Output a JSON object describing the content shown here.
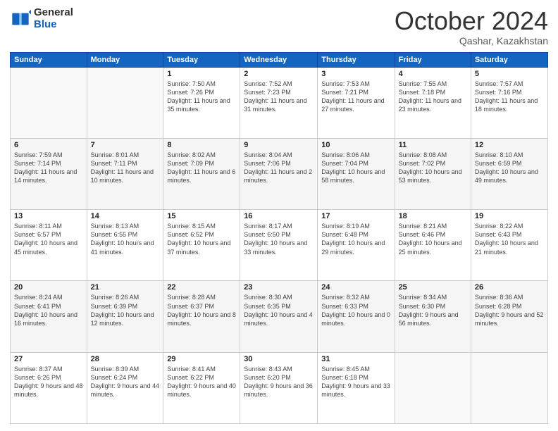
{
  "header": {
    "logo_general": "General",
    "logo_blue": "Blue",
    "month": "October 2024",
    "location": "Qashar, Kazakhstan"
  },
  "weekdays": [
    "Sunday",
    "Monday",
    "Tuesday",
    "Wednesday",
    "Thursday",
    "Friday",
    "Saturday"
  ],
  "weeks": [
    [
      {
        "day": "",
        "info": ""
      },
      {
        "day": "",
        "info": ""
      },
      {
        "day": "1",
        "info": "Sunrise: 7:50 AM\nSunset: 7:26 PM\nDaylight: 11 hours and 35 minutes."
      },
      {
        "day": "2",
        "info": "Sunrise: 7:52 AM\nSunset: 7:23 PM\nDaylight: 11 hours and 31 minutes."
      },
      {
        "day": "3",
        "info": "Sunrise: 7:53 AM\nSunset: 7:21 PM\nDaylight: 11 hours and 27 minutes."
      },
      {
        "day": "4",
        "info": "Sunrise: 7:55 AM\nSunset: 7:18 PM\nDaylight: 11 hours and 23 minutes."
      },
      {
        "day": "5",
        "info": "Sunrise: 7:57 AM\nSunset: 7:16 PM\nDaylight: 11 hours and 18 minutes."
      }
    ],
    [
      {
        "day": "6",
        "info": "Sunrise: 7:59 AM\nSunset: 7:14 PM\nDaylight: 11 hours and 14 minutes."
      },
      {
        "day": "7",
        "info": "Sunrise: 8:01 AM\nSunset: 7:11 PM\nDaylight: 11 hours and 10 minutes."
      },
      {
        "day": "8",
        "info": "Sunrise: 8:02 AM\nSunset: 7:09 PM\nDaylight: 11 hours and 6 minutes."
      },
      {
        "day": "9",
        "info": "Sunrise: 8:04 AM\nSunset: 7:06 PM\nDaylight: 11 hours and 2 minutes."
      },
      {
        "day": "10",
        "info": "Sunrise: 8:06 AM\nSunset: 7:04 PM\nDaylight: 10 hours and 58 minutes."
      },
      {
        "day": "11",
        "info": "Sunrise: 8:08 AM\nSunset: 7:02 PM\nDaylight: 10 hours and 53 minutes."
      },
      {
        "day": "12",
        "info": "Sunrise: 8:10 AM\nSunset: 6:59 PM\nDaylight: 10 hours and 49 minutes."
      }
    ],
    [
      {
        "day": "13",
        "info": "Sunrise: 8:11 AM\nSunset: 6:57 PM\nDaylight: 10 hours and 45 minutes."
      },
      {
        "day": "14",
        "info": "Sunrise: 8:13 AM\nSunset: 6:55 PM\nDaylight: 10 hours and 41 minutes."
      },
      {
        "day": "15",
        "info": "Sunrise: 8:15 AM\nSunset: 6:52 PM\nDaylight: 10 hours and 37 minutes."
      },
      {
        "day": "16",
        "info": "Sunrise: 8:17 AM\nSunset: 6:50 PM\nDaylight: 10 hours and 33 minutes."
      },
      {
        "day": "17",
        "info": "Sunrise: 8:19 AM\nSunset: 6:48 PM\nDaylight: 10 hours and 29 minutes."
      },
      {
        "day": "18",
        "info": "Sunrise: 8:21 AM\nSunset: 6:46 PM\nDaylight: 10 hours and 25 minutes."
      },
      {
        "day": "19",
        "info": "Sunrise: 8:22 AM\nSunset: 6:43 PM\nDaylight: 10 hours and 21 minutes."
      }
    ],
    [
      {
        "day": "20",
        "info": "Sunrise: 8:24 AM\nSunset: 6:41 PM\nDaylight: 10 hours and 16 minutes."
      },
      {
        "day": "21",
        "info": "Sunrise: 8:26 AM\nSunset: 6:39 PM\nDaylight: 10 hours and 12 minutes."
      },
      {
        "day": "22",
        "info": "Sunrise: 8:28 AM\nSunset: 6:37 PM\nDaylight: 10 hours and 8 minutes."
      },
      {
        "day": "23",
        "info": "Sunrise: 8:30 AM\nSunset: 6:35 PM\nDaylight: 10 hours and 4 minutes."
      },
      {
        "day": "24",
        "info": "Sunrise: 8:32 AM\nSunset: 6:33 PM\nDaylight: 10 hours and 0 minutes."
      },
      {
        "day": "25",
        "info": "Sunrise: 8:34 AM\nSunset: 6:30 PM\nDaylight: 9 hours and 56 minutes."
      },
      {
        "day": "26",
        "info": "Sunrise: 8:36 AM\nSunset: 6:28 PM\nDaylight: 9 hours and 52 minutes."
      }
    ],
    [
      {
        "day": "27",
        "info": "Sunrise: 8:37 AM\nSunset: 6:26 PM\nDaylight: 9 hours and 48 minutes."
      },
      {
        "day": "28",
        "info": "Sunrise: 8:39 AM\nSunset: 6:24 PM\nDaylight: 9 hours and 44 minutes."
      },
      {
        "day": "29",
        "info": "Sunrise: 8:41 AM\nSunset: 6:22 PM\nDaylight: 9 hours and 40 minutes."
      },
      {
        "day": "30",
        "info": "Sunrise: 8:43 AM\nSunset: 6:20 PM\nDaylight: 9 hours and 36 minutes."
      },
      {
        "day": "31",
        "info": "Sunrise: 8:45 AM\nSunset: 6:18 PM\nDaylight: 9 hours and 33 minutes."
      },
      {
        "day": "",
        "info": ""
      },
      {
        "day": "",
        "info": ""
      }
    ]
  ]
}
